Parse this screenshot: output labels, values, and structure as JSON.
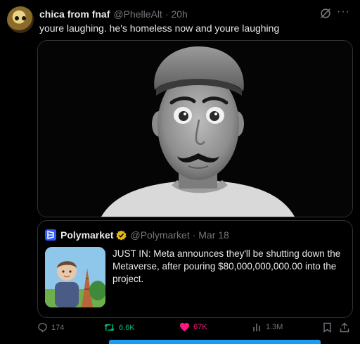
{
  "post": {
    "author_name": "chica from fnaf",
    "author_handle": "@PhelleAlt",
    "time": "· 20h",
    "text": "youre laughing. he's homeless now and youre laughing",
    "more_label": "···"
  },
  "quote": {
    "author_name": "Polymarket",
    "author_handle": "@Polymarket",
    "time": "· Mar 18",
    "text": "JUST IN: Meta announces they'll be shutting down the Metaverse, after pouring $80,000,000,000.00 into the project."
  },
  "actions": {
    "replies": "174",
    "reposts": "6.6K",
    "likes": "67K",
    "views": "1.3M"
  },
  "colors": {
    "background": "#000000",
    "text": "#e7e9ea",
    "muted": "#71767b",
    "repost_green": "#00ba7c",
    "like_pink": "#f91880",
    "accent_blue": "#1d9bf0"
  }
}
